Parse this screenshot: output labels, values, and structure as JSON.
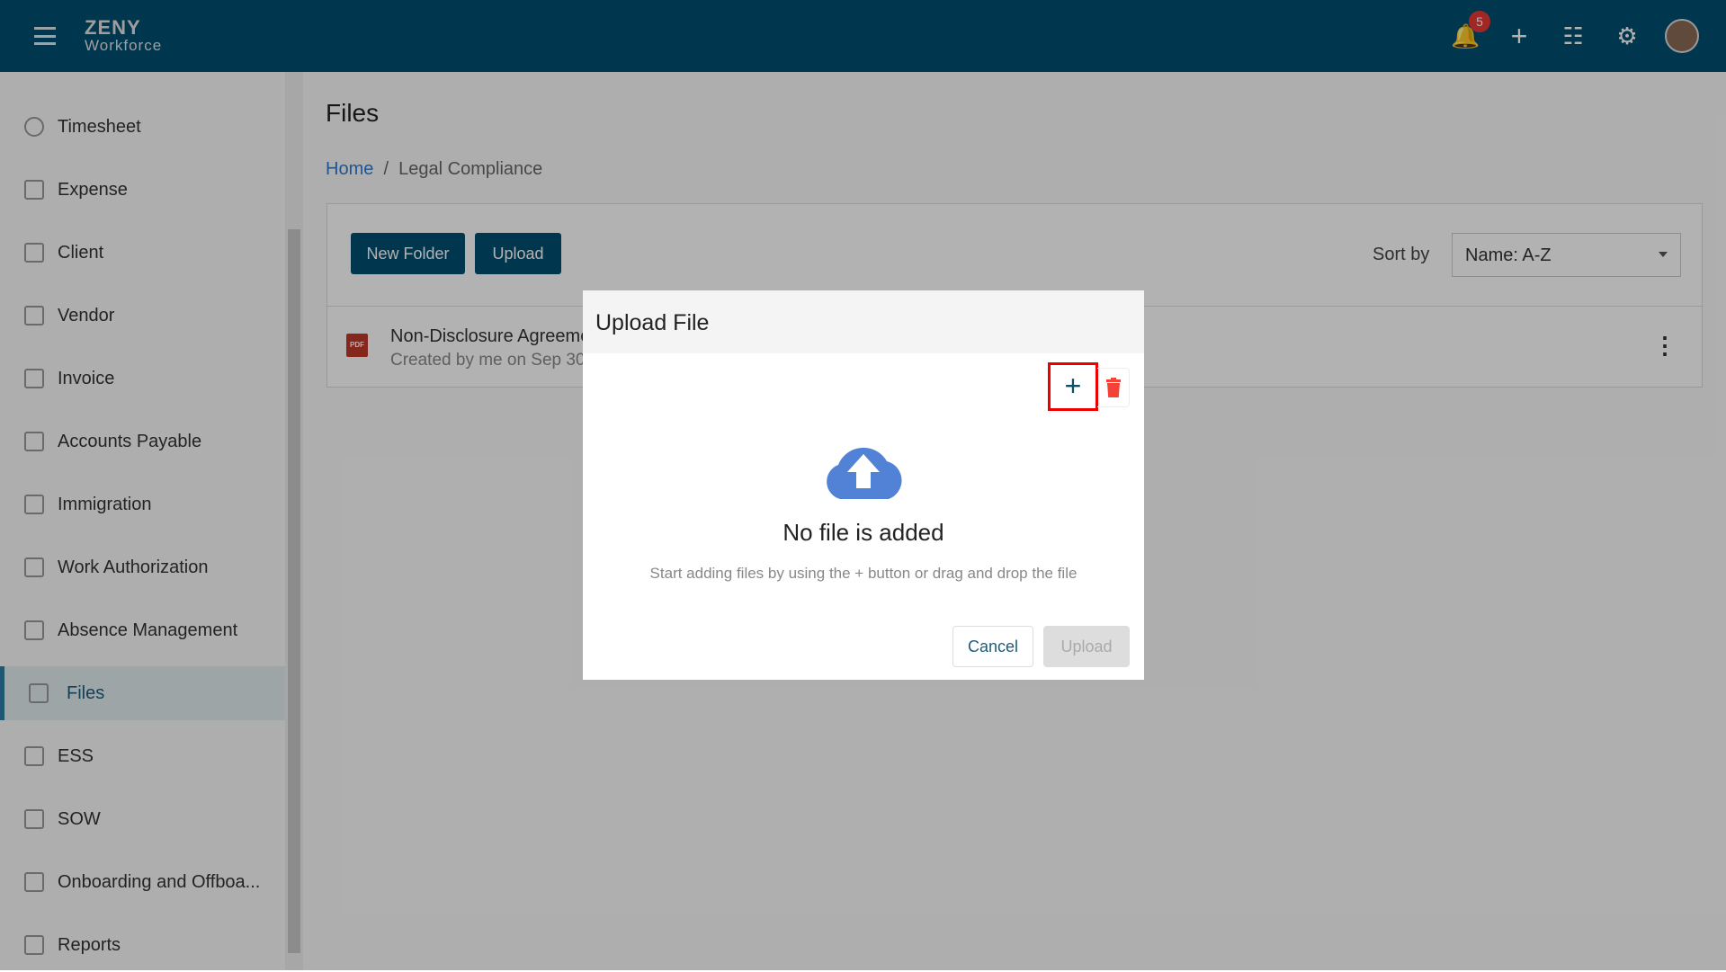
{
  "header": {
    "logo_top": "ZENY",
    "logo_bottom": "Workforce",
    "notification_count": "5"
  },
  "sidebar": {
    "items": [
      {
        "label": "Timesheet",
        "icon": "clock-icon"
      },
      {
        "label": "Expense",
        "icon": "expense-icon"
      },
      {
        "label": "Client",
        "icon": "user-icon"
      },
      {
        "label": "Vendor",
        "icon": "vendor-icon"
      },
      {
        "label": "Invoice",
        "icon": "invoice-icon"
      },
      {
        "label": "Accounts Payable",
        "icon": "payable-icon"
      },
      {
        "label": "Immigration",
        "icon": "globe-icon"
      },
      {
        "label": "Work Authorization",
        "icon": "briefcase-icon"
      },
      {
        "label": "Absence Management",
        "icon": "door-icon"
      },
      {
        "label": "Files",
        "icon": "file-icon",
        "active": true
      },
      {
        "label": "ESS",
        "icon": "ess-icon"
      },
      {
        "label": "SOW",
        "icon": "sow-icon"
      },
      {
        "label": "Onboarding and Offboa...",
        "icon": "id-card-icon"
      },
      {
        "label": "Reports",
        "icon": "report-icon"
      }
    ]
  },
  "main": {
    "title": "Files",
    "breadcrumb": {
      "home": "Home",
      "sep": "/",
      "current": "Legal Compliance"
    },
    "toolbar": {
      "new_folder": "New Folder",
      "upload": "Upload",
      "sort_label": "Sort by",
      "sort_value": "Name: A-Z"
    },
    "files": [
      {
        "name": "Non-Disclosure Agreement",
        "meta": "Created by me on Sep 30",
        "type_badge": "PDF"
      }
    ]
  },
  "dialog": {
    "title": "Upload File",
    "add_label": "+",
    "empty_title": "No file is added",
    "empty_hint": "Start adding files by using the + button or drag and drop the file",
    "cancel": "Cancel",
    "upload": "Upload",
    "colors": {
      "cloud": "#5282d6",
      "delete": "#f44336",
      "highlight": "#ee0000"
    }
  }
}
